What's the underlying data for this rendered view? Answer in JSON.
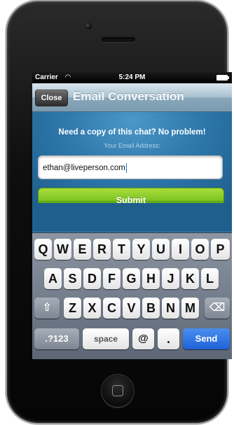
{
  "status_bar": {
    "carrier": "Carrier",
    "time": "5:24 PM",
    "wifi_icon": "◠"
  },
  "navbar": {
    "close_label": "Close",
    "title": "Email Conversation"
  },
  "content": {
    "prompt": "Need a copy of this chat? No problem!",
    "email_label": "Your Email Address:",
    "email_value": "ethan@liveperson.com",
    "submit_label": "Submit"
  },
  "keyboard": {
    "row1": [
      "Q",
      "W",
      "E",
      "R",
      "T",
      "Y",
      "U",
      "I",
      "O",
      "P"
    ],
    "row2": [
      "A",
      "S",
      "D",
      "F",
      "G",
      "H",
      "J",
      "K",
      "L"
    ],
    "row3": [
      "Z",
      "X",
      "C",
      "V",
      "B",
      "N",
      "M"
    ],
    "shift_icon": "⇧",
    "backspace_icon": "⌫",
    "numbers_label": ".?123",
    "space_label": "space",
    "at_label": "@",
    "dot_label": ".",
    "send_label": "Send"
  },
  "colors": {
    "accent_green": "#7cc424",
    "send_blue": "#1e62d6",
    "navbar": "#a8c0cf"
  }
}
